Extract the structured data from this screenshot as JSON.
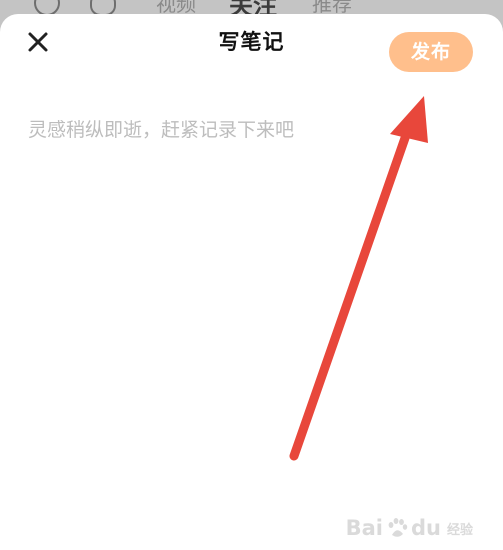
{
  "underlay": {
    "tab_a": "视频",
    "tab_b": "关注",
    "tab_c": "推荐"
  },
  "header": {
    "title": "写笔记",
    "publish_label": "发布",
    "close_icon": "close-icon"
  },
  "editor": {
    "placeholder": "灵感稍纵即逝，赶紧记录下来吧",
    "value": ""
  },
  "watermark": {
    "brand": "Bai",
    "brand_tail": "du",
    "sub": "经验"
  },
  "colors": {
    "publish_bg": "#ffbf8c",
    "arrow": "#e8473b",
    "placeholder": "#bdbdbd"
  }
}
